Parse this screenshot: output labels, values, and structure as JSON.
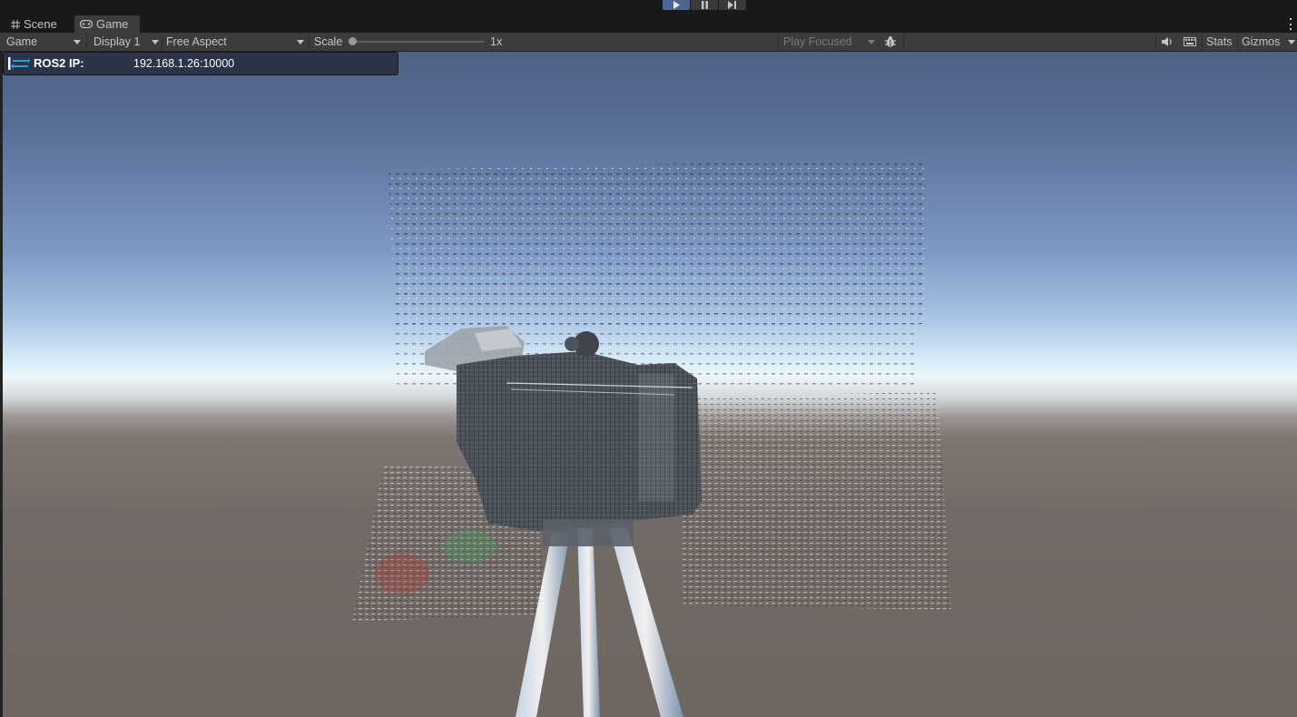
{
  "tabs": [
    {
      "label": "Scene",
      "icon": "grid-icon"
    },
    {
      "label": "Game",
      "icon": "gamepad-icon",
      "active": true
    }
  ],
  "play_controls": {
    "play": {
      "icon": "play-icon",
      "active": true
    },
    "pause": {
      "icon": "pause-icon"
    },
    "step": {
      "icon": "step-icon"
    }
  },
  "toolbar": {
    "view_mode": "Game",
    "display": "Display 1",
    "aspect": "Free Aspect",
    "scale_label": "Scale",
    "scale_value": "1x",
    "scale_fraction": 0.0,
    "play_mode": "Play Focused",
    "stats_label": "Stats",
    "gizmos_label": "Gizmos",
    "icons": [
      "bug-icon",
      "speaker-icon",
      "keyboard-icon"
    ]
  },
  "ros_panel": {
    "label": "ROS2 IP:",
    "value": "192.168.1.26:10000",
    "icon": "ros-connection-arrows-icon"
  },
  "colors": {
    "accent": "#4a6791",
    "panel_bg": "#3c3c3c",
    "ros_arrow_color": "#1fa3e6"
  }
}
